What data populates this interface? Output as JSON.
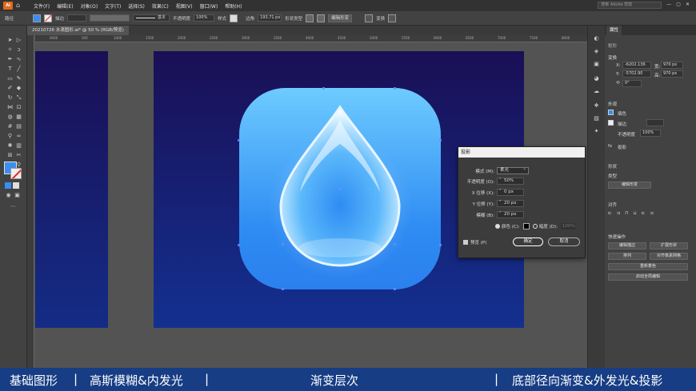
{
  "menubar": {
    "logo": "Ai",
    "items": [
      "文件(F)",
      "编辑(E)",
      "对象(O)",
      "文字(T)",
      "选择(S)",
      "效果(C)",
      "视图(V)",
      "窗口(W)",
      "帮助(H)"
    ],
    "search_placeholder": "搜索 Adobe 帮助"
  },
  "control_bar": {
    "label_path": "路径",
    "stroke_label": "描边",
    "stroke_style": "基本",
    "opacity_label": "不透明度",
    "opacity_value": "100%",
    "style_label": "样式",
    "corner_label": "边角",
    "corner_value": "193.71 px",
    "shape_type_label": "形状类型",
    "edit_shape_label": "编辑形变",
    "transform_label": "变换"
  },
  "document_tab": {
    "title": "20210726 水滴图形.ai* @ 50 % (RGB/预览)"
  },
  "rulers": {
    "h_ticks": [
      "0000",
      "500",
      "1000",
      "1500",
      "2000",
      "2500",
      "3000",
      "3500",
      "4000",
      "4500",
      "5000",
      "5500",
      "6000",
      "6500",
      "7000",
      "7500",
      "8000"
    ]
  },
  "properties_panel": {
    "tab_label": "属性",
    "object_type": "矩形",
    "transform_label": "变换",
    "x_label": "X:",
    "x_value": "-6202.136",
    "y_label": "Y:",
    "y_value": "-5702.90",
    "w_label": "宽:",
    "w_value": "970 px",
    "h_label": "高:",
    "h_value": "970 px",
    "angle_value": "0°",
    "appearance_label": "外观",
    "fill_label": "填色",
    "stroke_label": "描边",
    "opacity_label": "不透明度",
    "opacity_value": "100%",
    "fx_label": "投影",
    "shape_label": "形状",
    "shape_type_label": "类型",
    "edit_shape_button": "编辑形变",
    "align_label": "对齐",
    "quick_actions_label": "快速操作",
    "quick_buttons": [
      "编辑描边",
      "扩展形状",
      "排列",
      "对齐像素网格",
      "重新着色",
      "启动全局编辑"
    ]
  },
  "drop_shadow_dialog": {
    "title": "投影",
    "mode_label": "模式 (M):",
    "mode_value": "柔光",
    "opacity_label": "不透明度 (O):",
    "opacity_value": "50%",
    "x_offset_label": "X 位移 (X):",
    "x_offset_value": "0 px",
    "y_offset_label": "Y 位移 (Y):",
    "y_offset_value": "20 px",
    "blur_label": "模糊 (B):",
    "blur_value": "20 px",
    "color_radio_label": "颜色 (C):",
    "darkness_radio_label": "暗度 (D):",
    "darkness_value": "100%",
    "preview_label": "预览 (P)",
    "ok_button": "确定",
    "cancel_button": "取消"
  },
  "caption": {
    "segments": [
      "基础图形",
      "高斯模糊&内发光",
      "渐变层次",
      "底部径向渐变&外发光&投影"
    ],
    "separator": "|"
  },
  "colors": {
    "app_bg": "#535353",
    "artboard_top": "#1a0f55",
    "artboard_bottom": "#133090",
    "icon_top": "#6ecbff",
    "icon_bottom": "#2b80ee",
    "caption_bg": "#173d84"
  }
}
